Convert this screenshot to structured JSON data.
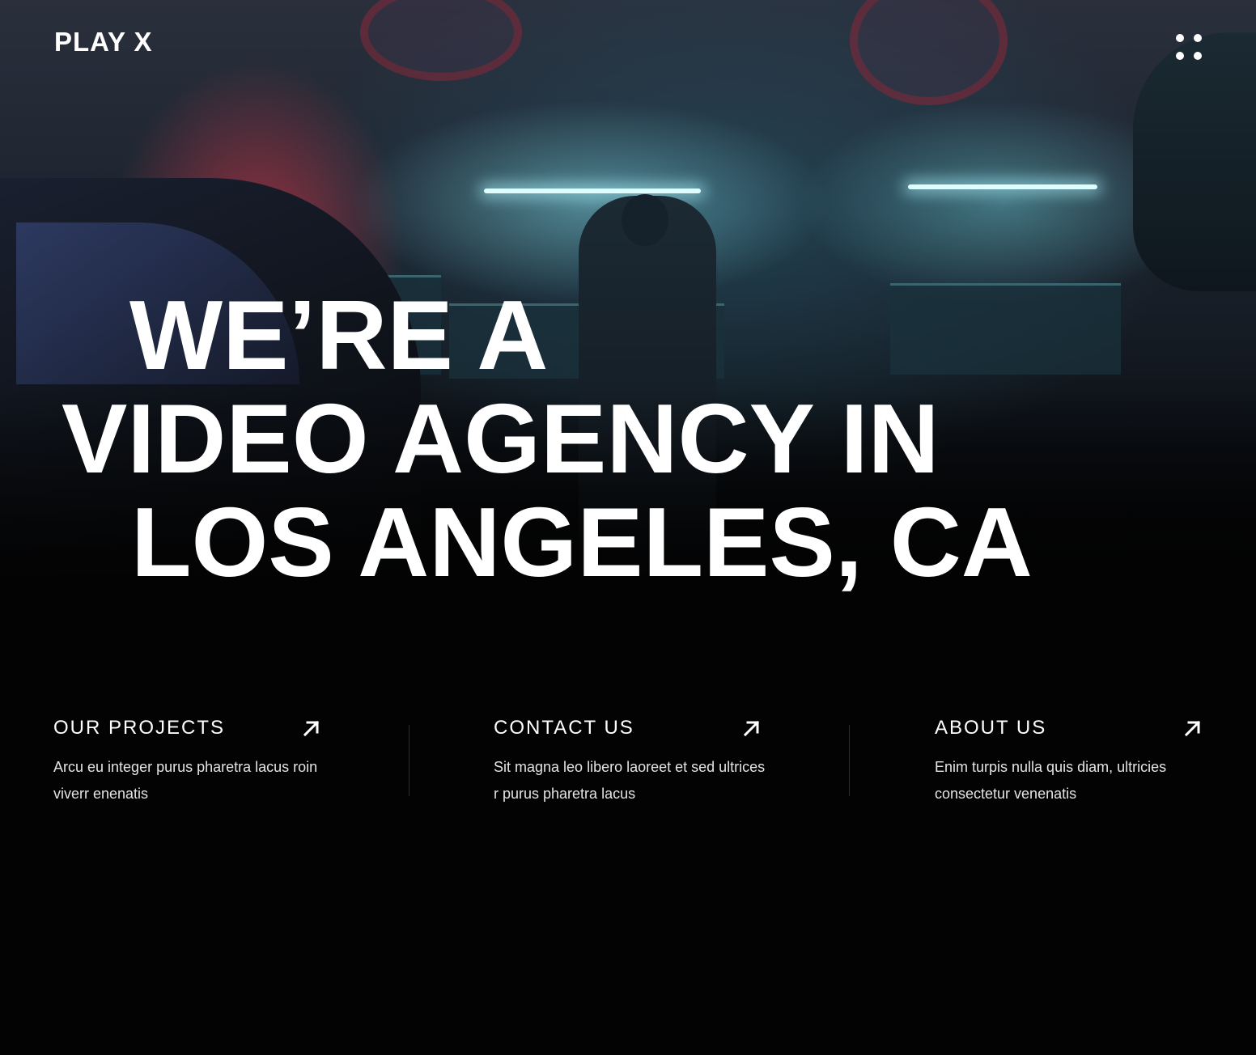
{
  "header": {
    "logo": "PLAY X",
    "menu_icon": "grid-dots-icon"
  },
  "hero": {
    "headline_lines": [
      "WE’RE A",
      "VIDEO AGENCY IN",
      "LOS ANGELES, CA"
    ],
    "background": "dark-garage-workshop-photo"
  },
  "links": [
    {
      "title": "OUR PROJECTS",
      "description": "Arcu eu integer purus pharetra lacus roin viverr enenatis",
      "icon": "arrow-up-right-icon"
    },
    {
      "title": "CONTACT US",
      "description": "Sit magna leo libero laoreet et sed ultrices r purus pharetra lacus",
      "icon": "arrow-up-right-icon"
    },
    {
      "title": "ABOUT US",
      "description": "Enim turpis nulla quis diam, ultricies consectetur venenatis",
      "icon": "arrow-up-right-icon"
    }
  ],
  "colors": {
    "background": "#030303",
    "text": "#ffffff",
    "divider": "#2c2c2c",
    "neon_red": "#ff3c48",
    "neon_cyan": "#dffcff"
  }
}
